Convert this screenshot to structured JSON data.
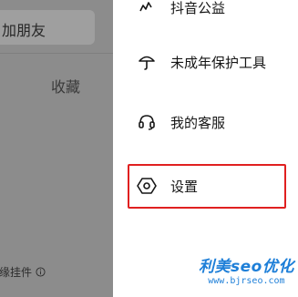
{
  "backdrop": {
    "add_friend_label": "加朋友",
    "favorites_label": "收藏",
    "widget_label": "缘挂件"
  },
  "drawer": {
    "items": [
      {
        "label": "抖音公益",
        "icon": "heart-chart-icon"
      },
      {
        "label": "未成年保护工具",
        "icon": "umbrella-icon"
      },
      {
        "label": "我的客服",
        "icon": "headset-icon"
      },
      {
        "label": "设置",
        "icon": "hexagon-gear-icon"
      }
    ]
  },
  "watermark": {
    "text": "利美seo优化",
    "url": "www.bjrseo.com"
  },
  "colors": {
    "highlight": "#e02020",
    "watermark": "#1e7fd8",
    "backdrop": "#8c8c8c"
  }
}
